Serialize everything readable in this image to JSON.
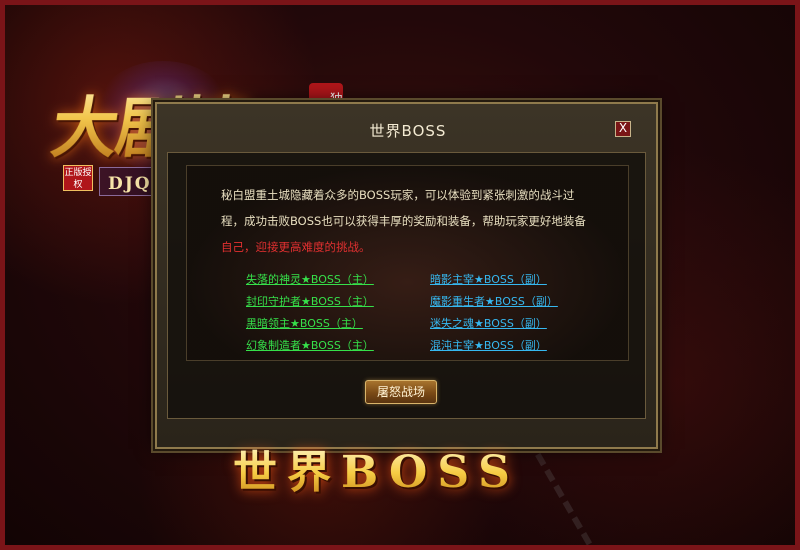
{
  "logo": {
    "title": "大剧情",
    "seal": "独家版",
    "badge": "正版授权",
    "subtitle": "DJQ 怀旧专属"
  },
  "dialog": {
    "title": "世界BOSS",
    "close_label": "X",
    "description_line1": "秘白盟重土城隐藏着众多的BOSS玩家，可以体验到紧张刺激的战斗过",
    "description_line2": "程，成功击败BOSS也可以获得丰厚的奖励和装备，帮助玩家更好地装备",
    "description_line3": "自己，迎接更高难度的挑战。",
    "bosses_left": [
      "失落的神灵★BOSS（主）",
      "封印守护者★BOSS（主）",
      "黑暗领主★BOSS（主）",
      "幻象制造者★BOSS（主）"
    ],
    "bosses_right": [
      "暗影主宰★BOSS（副）",
      "魔影重生者★BOSS（副）",
      "迷失之魂★BOSS（副）",
      "混沌主宰★BOSS（副）"
    ],
    "action_label": "屠怒战场"
  },
  "banner": {
    "title": "世界BOSS"
  },
  "colors": {
    "frame_border": "#7a1418",
    "link_main": "#36e04a",
    "link_sub": "#36b8f0",
    "highlight_text": "#e23030"
  }
}
